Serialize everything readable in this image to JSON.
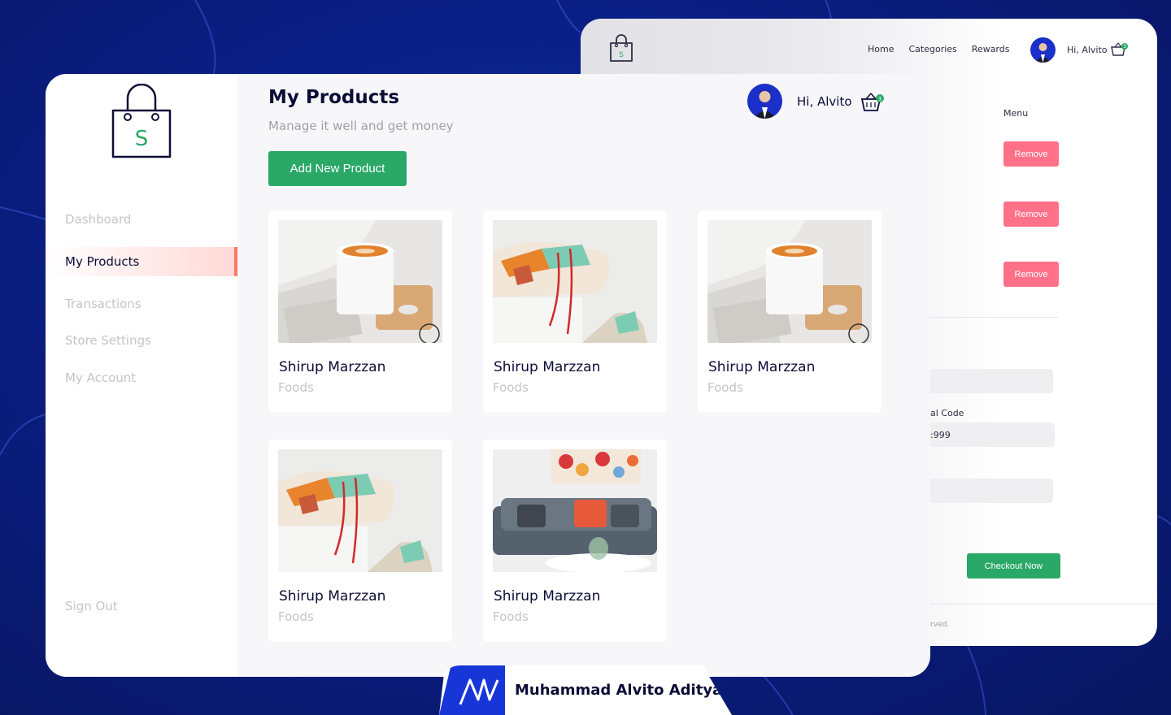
{
  "colors": {
    "background": "#0a1f86",
    "green": "#29a867",
    "red_button": "#ff7189",
    "active_accent": "#ff7966",
    "dark_text": "#0c0d36",
    "muted_text": "#c4c4cc"
  },
  "back_window": {
    "nav": [
      "Home",
      "Categories",
      "Rewards"
    ],
    "greeting": "Hi, Alvito",
    "cart_count": "3",
    "menu_label": "Menu",
    "remove_label": "Remove",
    "field_label": "al Code",
    "field_value": ":999",
    "checkout_label": "Checkout Now",
    "footer": "rved."
  },
  "sidebar": {
    "items": [
      "Dashboard",
      "My Products",
      "Transactions",
      "Store Settings",
      "My Account"
    ],
    "active": "My Products",
    "sign_out": "Sign Out",
    "logo_letter": "S"
  },
  "header": {
    "title": "My Products",
    "subtitle": "Manage it well and get money",
    "add_button": "Add New Product",
    "greeting": "Hi, Alvito",
    "cart_count": "3"
  },
  "products": [
    {
      "name": "Shirup Marzzan",
      "category": "Foods",
      "image": "coffee-cup"
    },
    {
      "name": "Shirup Marzzan",
      "category": "Foods",
      "image": "sneaker"
    },
    {
      "name": "Shirup Marzzan",
      "category": "Foods",
      "image": "coffee-cup"
    },
    {
      "name": "Shirup Marzzan",
      "category": "Foods",
      "image": "sneaker"
    },
    {
      "name": "Shirup Marzzan",
      "category": "Foods",
      "image": "sofa"
    }
  ],
  "author": "Muhammad Alvito Aditya"
}
